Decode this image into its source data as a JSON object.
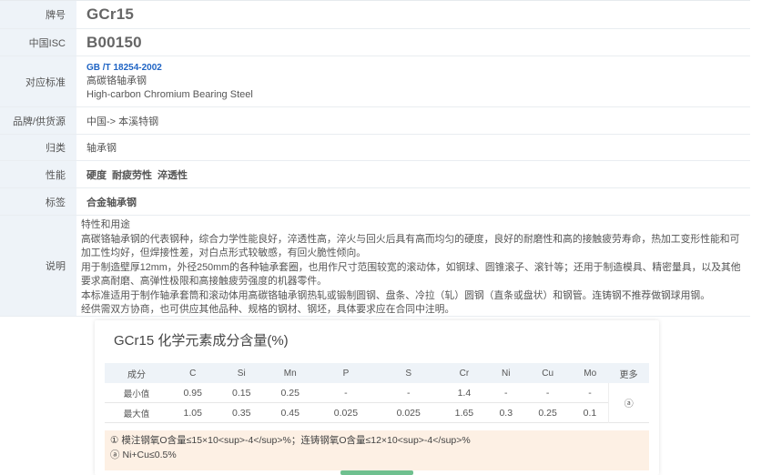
{
  "rows": {
    "grade": {
      "label": "牌号",
      "value": "GCr15"
    },
    "isc": {
      "label": "中国ISC",
      "value": "B00150"
    },
    "standard": {
      "label": "对应标准",
      "code": "GB /T 18254-2002",
      "name_cn": "高碳铬轴承钢",
      "name_en": "High-carbon Chromium Bearing Steel"
    },
    "supplier": {
      "label": "品牌/供货源",
      "value": "中国-> 本溪特钢"
    },
    "category": {
      "label": "归类",
      "value": "轴承钢"
    },
    "performance": {
      "label": "性能",
      "items": [
        "硬度",
        "耐疲劳性",
        "淬透性"
      ]
    },
    "tags": {
      "label": "标签",
      "value": "合金轴承钢"
    },
    "description": {
      "label": "说明",
      "lines": [
        "特性和用途",
        "高碳铬轴承钢的代表钢种，综合力学性能良好，淬透性高，淬火与回火后具有高而均匀的硬度，良好的耐磨性和高的接触疲劳寿命，热加工变形性能和可加工性均好，但焊接性差，对白点形式较敏感，有回火脆性倾向。",
        "用于制造壁厚12mm，外径250mm的各种轴承套圈，也用作尺寸范围较宽的滚动体，如钢球、圆锥滚子、滚针等；还用于制造模具、精密量具，以及其他要求高耐磨、高弹性极限和高接触疲劳强度的机器零件。",
        "本标准适用于制作轴承套筒和滚动体用高碳铬轴承钢热轧或锻制圆钢、盘条、冷拉（轧）圆钢（直条或盘状）和钢管。连铸钢不推荐做钢球用钢。",
        "经供需双方协商，也可供应其他品种、规格的钢材、钢坯，具体要求应在合同中注明。"
      ]
    }
  },
  "chem": {
    "title": "GCr15 化学元素成分含量(%)",
    "header_label": "成分",
    "elements": [
      "C",
      "Si",
      "Mn",
      "P",
      "S",
      "Cr",
      "Ni",
      "Cu",
      "Mo"
    ],
    "more_label": "更多",
    "more_value": "ⓐ",
    "rows": [
      {
        "label": "最小值",
        "values": [
          "0.95",
          "0.15",
          "0.25",
          "-",
          "-",
          "1.4",
          "-",
          "-",
          "-"
        ]
      },
      {
        "label": "最大值",
        "values": [
          "1.05",
          "0.35",
          "0.45",
          "0.025",
          "0.025",
          "1.65",
          "0.3",
          "0.25",
          "0.1"
        ]
      }
    ],
    "notes": [
      {
        "mark": "①",
        "text": "模注钢氧O含量≤15×10<sup>-4</sup>%；连铸钢氧O含量≤12×10<sup>-4</sup>%"
      },
      {
        "mark": "ⓐ",
        "text": "Ni+Cu≤0.5%"
      }
    ]
  }
}
